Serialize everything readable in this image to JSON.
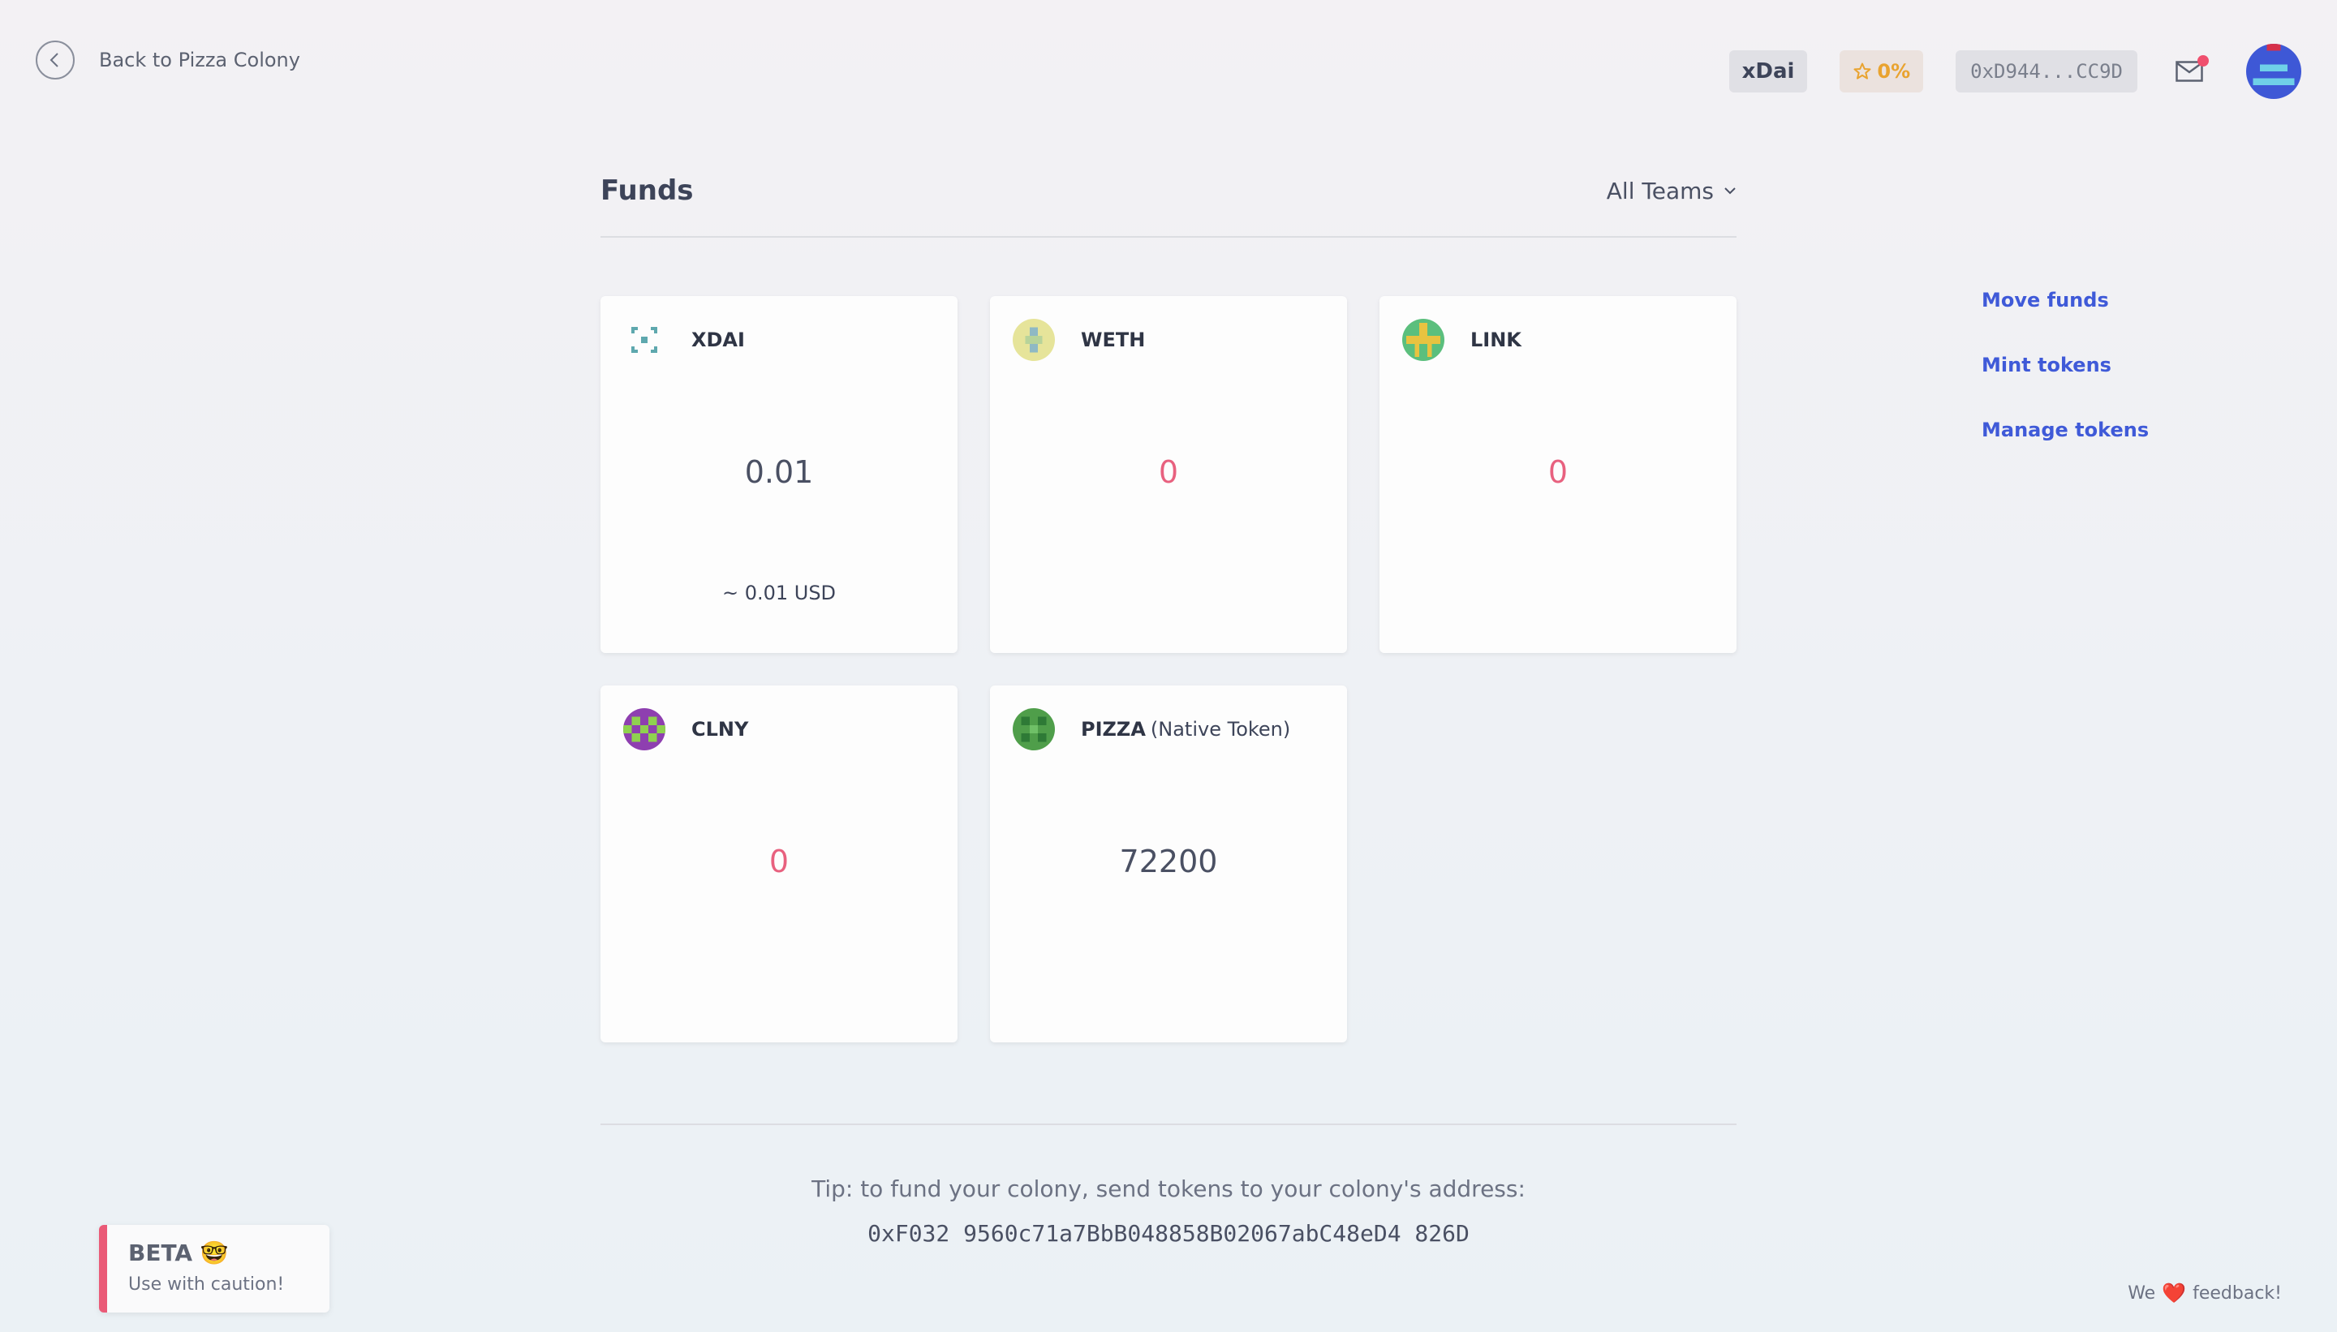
{
  "header": {
    "back_label": "Back to Pizza Colony",
    "network": "xDai",
    "reputation": "0%",
    "wallet_address": "0xD944...CC9D"
  },
  "funds": {
    "title": "Funds",
    "team_filter": "All Teams",
    "tokens": [
      {
        "symbol": "XDAI",
        "balance": "0.01",
        "usd": "~ 0.01 USD",
        "native_label": ""
      },
      {
        "symbol": "WETH",
        "balance": "0",
        "usd": "",
        "native_label": ""
      },
      {
        "symbol": "LINK",
        "balance": "0",
        "usd": "",
        "native_label": ""
      },
      {
        "symbol": "CLNY",
        "balance": "0",
        "usd": "",
        "native_label": ""
      },
      {
        "symbol": "PIZZA",
        "balance": "72200",
        "usd": "",
        "native_label": "(Native Token)"
      }
    ],
    "tip": "Tip: to fund your colony, send tokens to your colony's address:",
    "colony_address": "0xF032 9560c71a7BbB048858B02067abC48eD4 826D"
  },
  "actions": {
    "move_funds": "Move funds",
    "mint_tokens": "Mint tokens",
    "manage_tokens": "Manage tokens"
  },
  "beta": {
    "title": "BETA 🤓",
    "subtitle": "Use with caution!"
  },
  "feedback": {
    "prefix": "We",
    "heart": "❤️",
    "suffix": "feedback!"
  },
  "colors": {
    "accent": "#3f5ad8",
    "zero_balance": "#e8617f",
    "beta_bar": "#ea5a77",
    "reputation": "#e9a32f",
    "notification": "#f0506e"
  }
}
